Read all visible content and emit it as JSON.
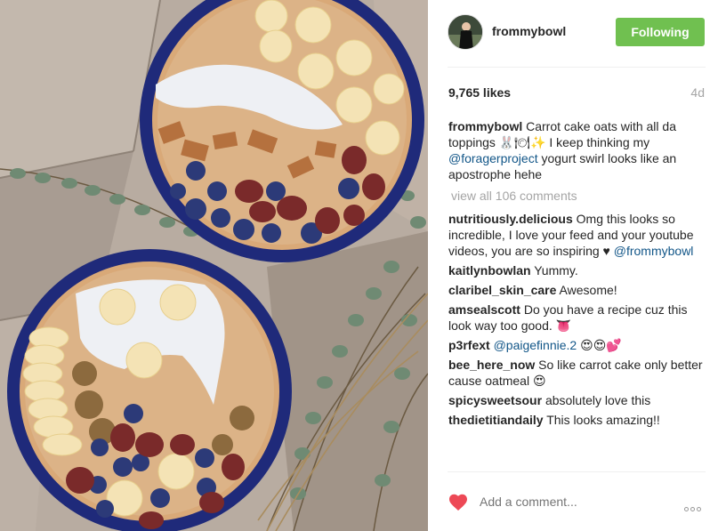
{
  "post": {
    "image_alt": "Carrot cake oats bowls",
    "username": "frommybowl",
    "follow_label": "Following",
    "likes": "9,765 likes",
    "age": "4d",
    "caption": {
      "username": "frommybowl",
      "text_1": "Carrot cake oats with all da toppings 🐰🍽✨ I keep thinking my",
      "mention": "@foragerproject",
      "text_2": "yogurt swirl looks like an apostrophe hehe"
    },
    "view_all": "view all 106 comments",
    "comments": [
      {
        "user": "nutritiously.delicious",
        "text": "Omg this looks so incredible, I love your feed and your youtube videos, you are so inspiring ♥",
        "mention": "@frommybowl"
      },
      {
        "user": "kaitlynbowlan",
        "text": "Yummy."
      },
      {
        "user": "claribel_skin_care",
        "text": "Awesome!"
      },
      {
        "user": "amsealscott",
        "text": "Do you have a recipe cuz this look way too good. 👅"
      },
      {
        "user": "p3rfext",
        "mention": "@paigefinnie.2",
        "text": "😍😍💕"
      },
      {
        "user": "bee_here_now",
        "text": "So like carrot cake only better cause oatmeal 😍"
      },
      {
        "user": "spicysweetsour",
        "text": "absolutely love this"
      },
      {
        "user": "thedietitiandaily",
        "text": "This looks amazing!!"
      }
    ],
    "add_comment_placeholder": "Add a comment...",
    "liked": true,
    "colors": {
      "follow_green": "#70c050",
      "heart_red": "#ed4956",
      "mention_blue": "#125688"
    }
  }
}
